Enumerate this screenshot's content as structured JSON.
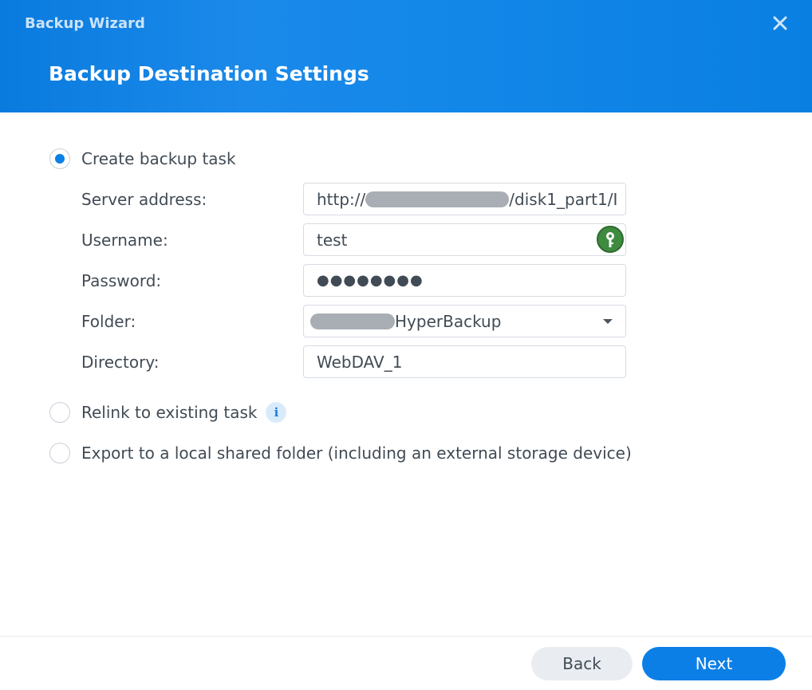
{
  "window": {
    "title": "Backup Wizard",
    "close_icon": "close-icon"
  },
  "page": {
    "title": "Backup Destination Settings"
  },
  "options": {
    "create": {
      "label": "Create backup task",
      "checked": true
    },
    "relink": {
      "label": "Relink to existing task",
      "checked": false,
      "info_icon": "i"
    },
    "export": {
      "label": "Export to a local shared folder (including an external storage device)",
      "checked": false
    }
  },
  "form": {
    "server_address": {
      "label": "Server address:",
      "value_prefix": "http://",
      "value_suffix": "/disk1_part1/I"
    },
    "username": {
      "label": "Username:",
      "value": "test"
    },
    "password": {
      "label": "Password:",
      "value": "●●●●●●●●"
    },
    "folder": {
      "label": "Folder:",
      "value_suffix": "HyperBackup"
    },
    "directory": {
      "label": "Directory:",
      "value": "WebDAV_1"
    }
  },
  "footer": {
    "back_label": "Back",
    "next_label": "Next"
  },
  "colors": {
    "accent": "#0b7fe6",
    "header": "#1287e8"
  }
}
